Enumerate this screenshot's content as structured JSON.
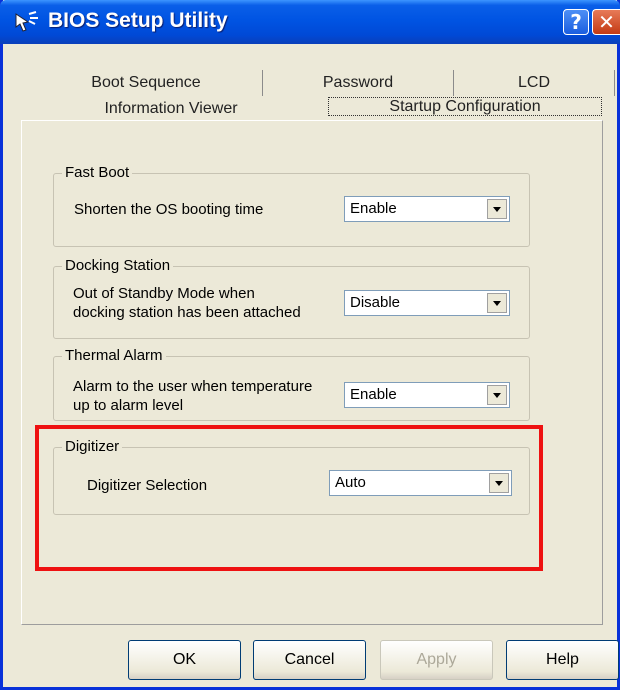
{
  "window": {
    "title": "BIOS Setup Utility"
  },
  "tabs": {
    "row1": [
      "Boot Sequence",
      "Password",
      "LCD"
    ],
    "row2": [
      "Information Viewer",
      "Startup Configuration"
    ],
    "active": "Startup Configuration"
  },
  "groups": {
    "fast_boot": {
      "title": "Fast Boot",
      "label": "Shorten the OS booting time",
      "value": "Enable"
    },
    "docking": {
      "title": "Docking Station",
      "label_line1": "Out of Standby Mode when",
      "label_line2": "docking station has been attached",
      "value": "Disable"
    },
    "thermal": {
      "title": "Thermal Alarm",
      "label_line1": "Alarm to the user when temperature",
      "label_line2": "up to alarm level",
      "value": "Enable"
    },
    "digitizer": {
      "title": "Digitizer",
      "label": "Digitizer Selection",
      "value": "Auto"
    }
  },
  "buttons": {
    "ok": "OK",
    "cancel": "Cancel",
    "apply": "Apply",
    "help": "Help"
  },
  "colors": {
    "titlebar": "#0054e3",
    "highlight": "#ee1111",
    "face": "#ece9d8"
  },
  "icons": {
    "app": "pointer-icon",
    "help": "question-icon",
    "close": "close-icon"
  }
}
